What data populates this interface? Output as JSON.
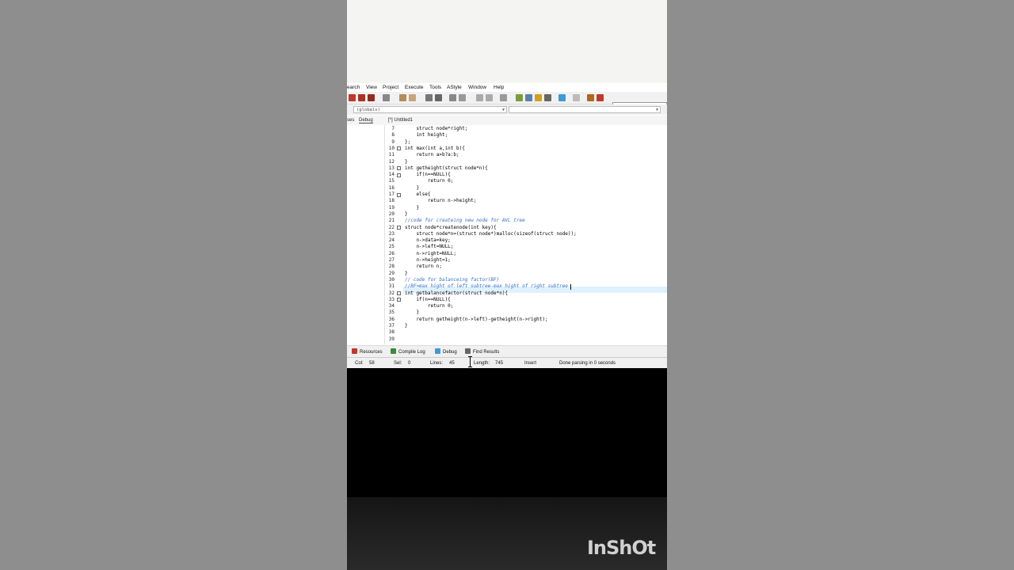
{
  "menu": [
    "earch",
    "View",
    "Project",
    "Execute",
    "Tools",
    "AStyle",
    "Window",
    "Help"
  ],
  "compiler": "TDM-GCC 4.9.2 64-",
  "class_combo": "(globals)",
  "left_tabs": [
    "ses",
    "Debug"
  ],
  "file_tab": "[*] Untitled1",
  "code_lines": [
    {
      "n": "7",
      "text": "    struct node*right;"
    },
    {
      "n": "8",
      "text": "    int height;"
    },
    {
      "n": "9",
      "text": "};"
    },
    {
      "n": "10",
      "text": "int max(int a,int b){"
    },
    {
      "n": "11",
      "text": "    return a>b?a:b;"
    },
    {
      "n": "12",
      "text": "}"
    },
    {
      "n": "13",
      "text": "int getheight(struct node*n){"
    },
    {
      "n": "14",
      "text": "    if(n==NULL){"
    },
    {
      "n": "15",
      "text": "        return 0;"
    },
    {
      "n": "16",
      "text": "    }"
    },
    {
      "n": "17",
      "text": "    else{"
    },
    {
      "n": "18",
      "text": "        return n->height;"
    },
    {
      "n": "19",
      "text": "    }"
    },
    {
      "n": "20",
      "text": "}"
    },
    {
      "n": "21",
      "text": "//code for createing new node for AVL tree"
    },
    {
      "n": "22",
      "text": "struct node*createnode(int key){"
    },
    {
      "n": "23",
      "text": "    struct node*n=(struct node*)malloc(sizeof(struct node));"
    },
    {
      "n": "24",
      "text": "    n->data=key;"
    },
    {
      "n": "25",
      "text": "    n->left=NULL;"
    },
    {
      "n": "26",
      "text": "    n->right=NULL;"
    },
    {
      "n": "27",
      "text": "    n->height=1;"
    },
    {
      "n": "28",
      "text": "    return n;"
    },
    {
      "n": "29",
      "text": "}"
    },
    {
      "n": "30",
      "text": "// code for balanceing factor(BF)"
    },
    {
      "n": "31",
      "text": "//BF=max hight of left subtree-max hight of right subtree"
    },
    {
      "n": "32",
      "text": "int getbalancefactor(struct node*n){"
    },
    {
      "n": "33",
      "text": "    if(n==NULL){"
    },
    {
      "n": "34",
      "text": "        return 0;"
    },
    {
      "n": "35",
      "text": "    }"
    },
    {
      "n": "36",
      "text": "    return getheight(n->left)-getheight(n->right);"
    },
    {
      "n": "37",
      "text": "}"
    },
    {
      "n": "38",
      "text": ""
    },
    {
      "n": "39",
      "text": ""
    }
  ],
  "bottom_tabs": [
    "Resources",
    "Compile Log",
    "Debug",
    "Find Results"
  ],
  "status": {
    "col_label": "Col:",
    "col": "58",
    "sel_label": "Sel:",
    "sel": "0",
    "lines_label": "Lines:",
    "lines": "45",
    "length_label": "Length:",
    "length": "745",
    "mode": "Insert",
    "message": "Done parsing in 0 seconds"
  },
  "watermark": "InShOt",
  "colors": {
    "comment": "#3a6fc4",
    "current_line": "#dff1ff",
    "toolbar": "#f1f1f1"
  }
}
